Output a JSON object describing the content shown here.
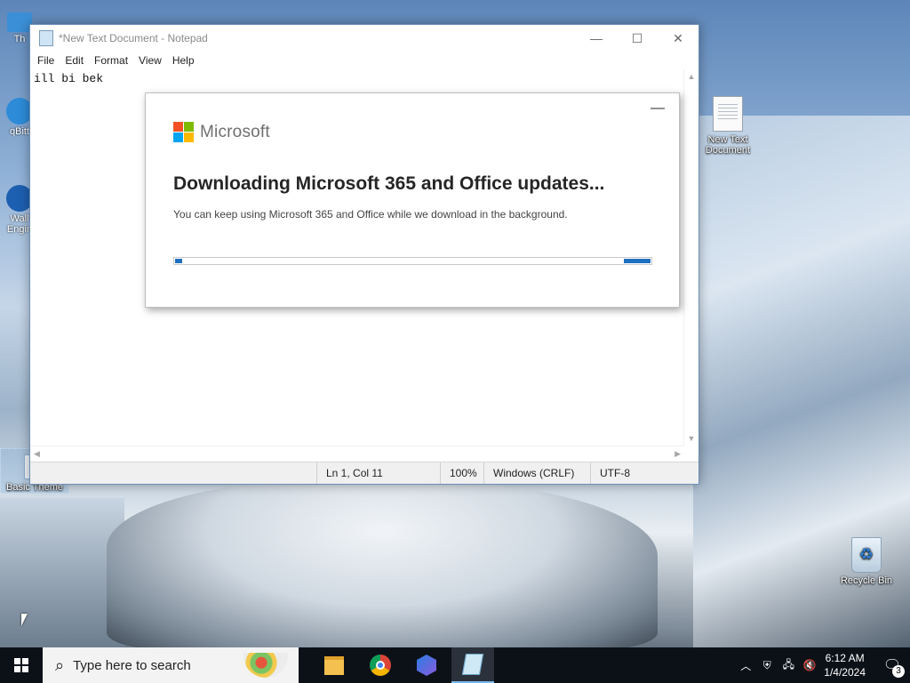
{
  "desktop": {
    "icons": {
      "new_text_document": "New Text Document",
      "recycle_bin": "Recycle Bin",
      "basic_theme": "Basic Theme",
      "this_pc_partial": "Th",
      "qbittorrent_partial": "qBitt",
      "wallpaper_engine_partial_1": "Wall",
      "wallpaper_engine_partial_2": "Engin"
    }
  },
  "notepad": {
    "title": "*New Text Document - Notepad",
    "menu": [
      "File",
      "Edit",
      "Format",
      "View",
      "Help"
    ],
    "content": "ill bi bek",
    "status": {
      "position": "Ln 1, Col 11",
      "zoom": "100%",
      "line_endings": "Windows (CRLF)",
      "encoding": "UTF-8"
    }
  },
  "office_dialog": {
    "brand": "Microsoft",
    "heading": "Downloading Microsoft 365 and Office updates...",
    "message": "You can keep using Microsoft 365 and Office while we download in the background.",
    "progress_style": "indeterminate",
    "accent_color": "#1f6fc0",
    "logo_colors": [
      "#f25022",
      "#7fba00",
      "#00a4ef",
      "#ffb900"
    ]
  },
  "taskbar": {
    "search_placeholder": "Type here to search",
    "apps": [
      "file-explorer",
      "chrome",
      "copilot",
      "notepad"
    ],
    "clock_time": "6:12 AM",
    "clock_date": "1/4/2024",
    "notification_count": "3"
  }
}
